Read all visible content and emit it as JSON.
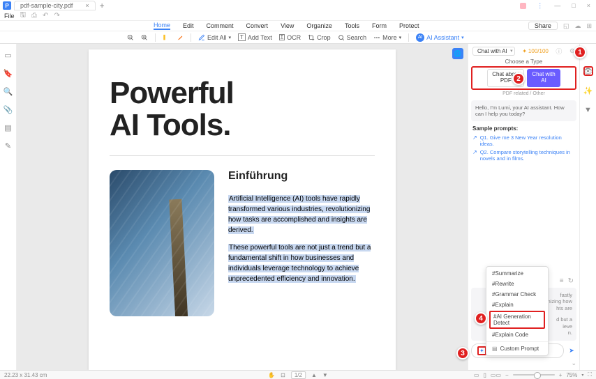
{
  "titlebar": {
    "tab_name": "pdf-sample-city.pdf",
    "window_min": "—",
    "window_max": "□",
    "window_close": "×"
  },
  "filebar": {
    "file_label": "File"
  },
  "menubar": {
    "items": [
      "Home",
      "Edit",
      "Comment",
      "Convert",
      "View",
      "Organize",
      "Tools",
      "Form",
      "Protect"
    ],
    "active_index": 0,
    "share_label": "Share"
  },
  "toolbar": {
    "edit_all": "Edit All",
    "add_text": "Add Text",
    "ocr": "OCR",
    "crop": "Crop",
    "search": "Search",
    "more": "More",
    "ai_assistant": "AI Assistant"
  },
  "document": {
    "title_line1": "Powerful",
    "title_line2": "AI Tools.",
    "subtitle": "Einführung",
    "para1": "Artificial Intelligence (AI) tools have rapidly transformed various industries, revolutionizing how tasks are accomplished and insights are derived.",
    "para2": "These powerful tools are not just a trend but a fundamental shift in how businesses and individuals leverage technology to achieve unprecedented efficiency and innovation."
  },
  "sidebar": {
    "chat_with_ai": "Chat with AI",
    "tokens": "100/100",
    "choose_type": "Choose a Type",
    "type1_line1": "Chat about",
    "type1_line2": "PDF",
    "type2_line1": "Chat with",
    "type2_line2": "AI",
    "subtype_label": "PDF related / Other",
    "greeting": "Hello, I'm Lumi, your AI assistant. How can I help you today?",
    "sample_label": "Sample prompts:",
    "prompts": [
      "Q1. Give me 3 New Year resolution ideas.",
      "Q2. Compare storytelling techniques in novels and in films."
    ],
    "hint1": "fastly",
    "hint2": "nizing how",
    "hint3": "hts are",
    "hint4": "d but a",
    "hint5": "ieve",
    "hint6": "n.",
    "input_placeholder": ""
  },
  "context_menu": {
    "items": [
      "#Summarize",
      "#Rewrite",
      "#Grammar Check",
      "#Explain",
      "#AI Generation Detect",
      "#Explain Code"
    ],
    "custom": "Custom Prompt",
    "highlighted_index": 4
  },
  "statusbar": {
    "dimensions": "22.23 x 31.43 cm",
    "page": "1/2",
    "zoom": "75%"
  },
  "annotations": {
    "n1": "1",
    "n2": "2",
    "n3": "3",
    "n4": "4"
  },
  "icons": {
    "diamond": "✦"
  }
}
